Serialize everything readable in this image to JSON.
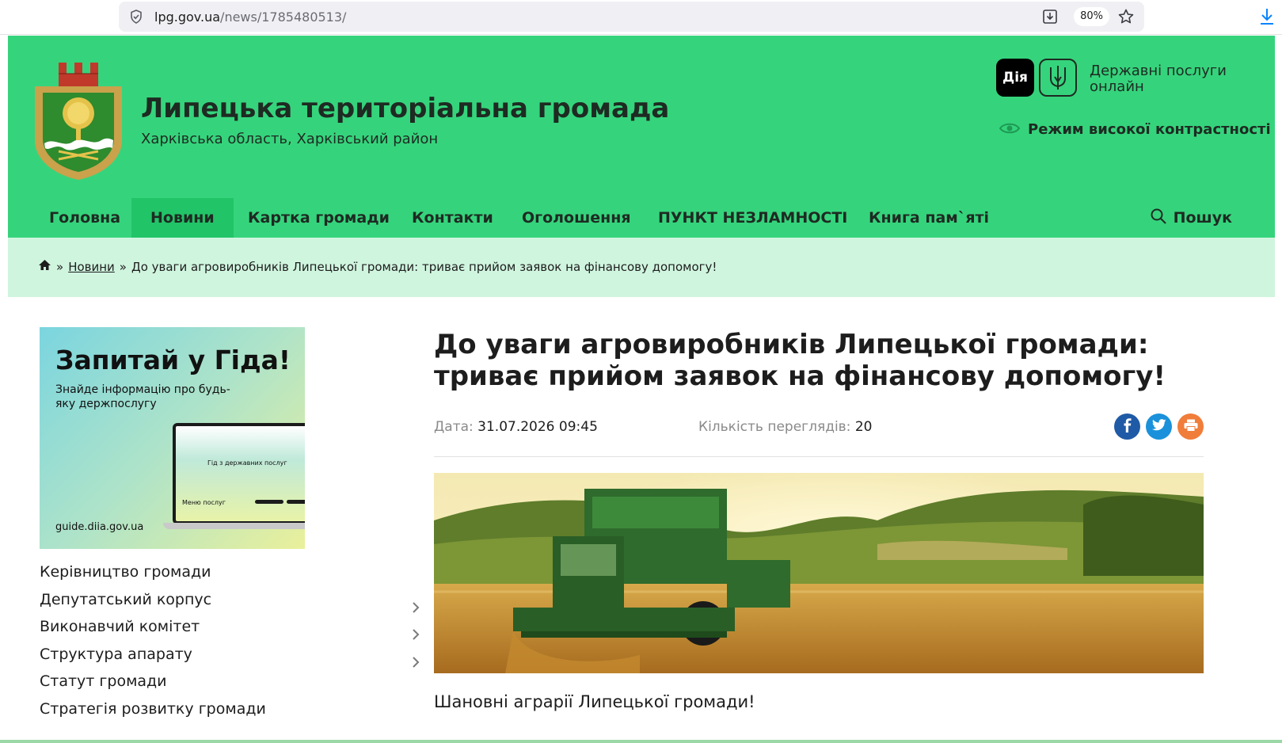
{
  "browser": {
    "url_domain": "lpg.gov.ua",
    "url_path": "/news/1785480513/",
    "zoom": "80%"
  },
  "header": {
    "title": "Липецька територіальна громада",
    "subtitle": "Харківська область, Харківський район",
    "diia_logo": "Дія",
    "gov_services": "Державні послуги онлайн",
    "contrast_label": "Режим високої контрастності",
    "colors": {
      "primary": "#35d47c",
      "nav_active": "#22c468",
      "breadcrumb_bg": "#d0f5df"
    }
  },
  "nav": {
    "items": [
      {
        "label": "Головна"
      },
      {
        "label": "Новини",
        "active": true
      },
      {
        "label": "Картка громади"
      },
      {
        "label": "Контакти"
      },
      {
        "label": "Оголошення"
      },
      {
        "label": "ПУНКТ НЕЗЛАМНОСТІ"
      },
      {
        "label": "Книга пам`яті"
      }
    ],
    "search_label": "Пошук"
  },
  "breadcrumb": {
    "separator": "»",
    "news_link": "Новини",
    "current": "До уваги агровиробників Липецької громади: триває прийом заявок на фінансову допомогу!"
  },
  "banner": {
    "title": "Запитай у Гіда!",
    "subtitle": "Знайде інформацію про будь-яку держпослугу",
    "url": "guide.diia.gov.ua",
    "screen_title": "Гід з державних послуг",
    "screen_menu": "Меню послуг"
  },
  "sidebar": {
    "items": [
      {
        "label": "Керівництво громади",
        "has_submenu": false
      },
      {
        "label": "Депутатський корпус",
        "has_submenu": true
      },
      {
        "label": "Виконавчий комітет",
        "has_submenu": true
      },
      {
        "label": "Структура апарату",
        "has_submenu": true
      },
      {
        "label": "Статут громади",
        "has_submenu": false
      },
      {
        "label": "Стратегія розвитку громади",
        "has_submenu": false
      }
    ]
  },
  "article": {
    "title": "До уваги агровиробників Липецької громади: триває прийом заявок на фінансову допомогу!",
    "date_label": "Дата:",
    "date_value": "31.07.2026 09:45",
    "views_label": "Кількість переглядів:",
    "views_value": "20",
    "greeting": "Шановні аграрії Липецької громади!",
    "share_icons": [
      "facebook-icon",
      "twitter-icon",
      "print-icon"
    ]
  }
}
